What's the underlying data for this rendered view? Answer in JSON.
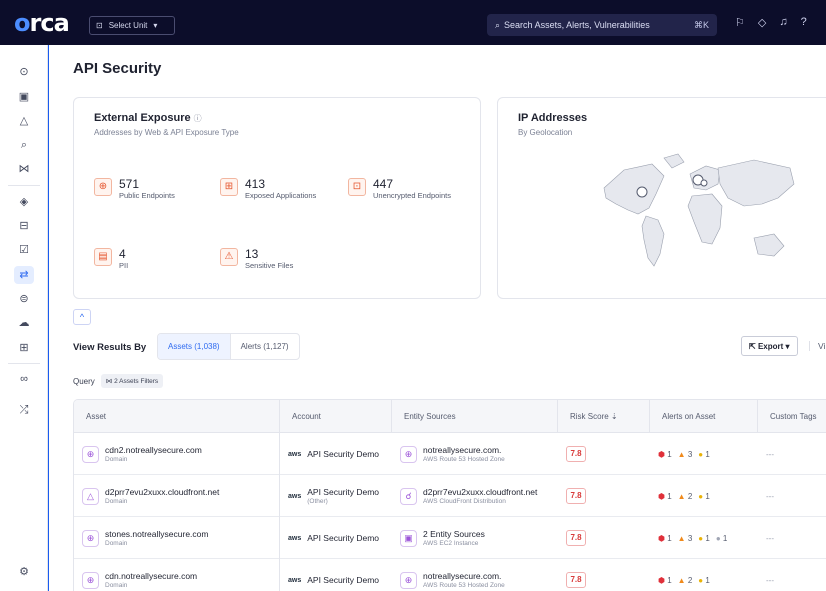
{
  "topbar": {
    "logo": "orca",
    "unit_label": "Select Unit",
    "search_placeholder": "Search Assets, Alerts, Vulnerabilities",
    "search_shortcut": "⌘K"
  },
  "page": {
    "title": "API Security"
  },
  "exposure": {
    "title": "External Exposure",
    "subtitle": "Addresses by Web & API Exposure Type",
    "stats": [
      {
        "value": "571",
        "label": "Public Endpoints",
        "icon": "globe-icon"
      },
      {
        "value": "413",
        "label": "Exposed Applications",
        "icon": "grid-icon"
      },
      {
        "value": "447",
        "label": "Unencrypted Endpoints",
        "icon": "unlock-icon"
      },
      {
        "value": "4",
        "label": "PII",
        "icon": "id-card-icon"
      },
      {
        "value": "13",
        "label": "Sensitive Files",
        "icon": "file-alert-icon"
      }
    ]
  },
  "ip": {
    "title": "IP Addresses",
    "subtitle": "By Geolocation"
  },
  "results": {
    "label": "View Results By",
    "tab_assets": "Assets (1,038)",
    "tab_alerts": "Alerts (1,127)",
    "export": "Export",
    "view": "Vi"
  },
  "query": {
    "label": "Query",
    "filter": "2 Assets Filters"
  },
  "table": {
    "headers": [
      "Asset",
      "Account",
      "Entity Sources",
      "Risk Score",
      "Alerts on Asset",
      "Custom Tags"
    ],
    "rows": [
      {
        "asset": "cdn2.notreallysecure.com",
        "asset_type": "Domain",
        "account": "API Security Demo",
        "account_sub": "",
        "source": "notreallysecure.com.",
        "source_sub": "AWS Route 53 Hosted Zone",
        "risk": "7.8",
        "a1": "1",
        "a2": "3",
        "a3": "1",
        "a4": "",
        "tags": "---"
      },
      {
        "asset": "d2prr7evu2xuxx.cloudfront.net",
        "asset_type": "Domain",
        "account": "API Security Demo",
        "account_sub": "(Other)",
        "source": "d2prr7evu2xuxx.cloudfront.net",
        "source_sub": "AWS CloudFront Distribution",
        "risk": "7.8",
        "a1": "1",
        "a2": "2",
        "a3": "1",
        "a4": "",
        "tags": "---"
      },
      {
        "asset": "stones.notreallysecure.com",
        "asset_type": "Domain",
        "account": "API Security Demo",
        "account_sub": "",
        "source": "2 Entity Sources",
        "source_sub": "AWS EC2 Instance",
        "risk": "7.8",
        "a1": "1",
        "a2": "3",
        "a3": "1",
        "a4": "1",
        "tags": "---"
      },
      {
        "asset": "cdn.notreallysecure.com",
        "asset_type": "Domain",
        "account": "API Security Demo",
        "account_sub": "",
        "source": "notreallysecure.com.",
        "source_sub": "AWS Route 53 Hosted Zone",
        "risk": "7.8",
        "a1": "1",
        "a2": "2",
        "a3": "1",
        "a4": "",
        "tags": "---"
      }
    ]
  },
  "colors": {
    "topbar": "#0c0d2a",
    "accent": "#2f6bf0",
    "risk": "#d83a3a",
    "background": "#1a5cf0"
  }
}
